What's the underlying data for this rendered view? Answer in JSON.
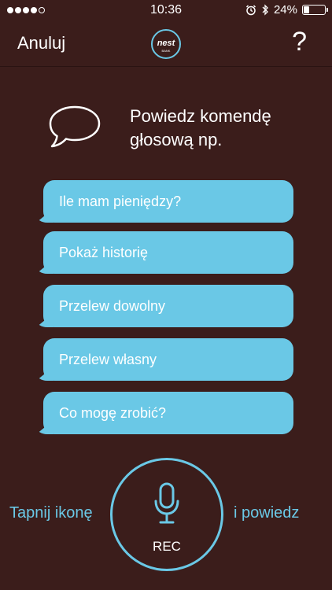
{
  "status_bar": {
    "time": "10:36",
    "battery_percent": "24%",
    "battery_level": 0.24,
    "signal_dots_filled": 4,
    "signal_dots_total": 5
  },
  "nav": {
    "cancel_label": "Anuluj",
    "logo_text": "nest",
    "logo_subtext": "BANK",
    "help_label": "?"
  },
  "prompt": {
    "line1": "Powiedz komendę",
    "line2": "głosową np."
  },
  "suggestions": [
    "Ile mam pieniędzy?",
    "Pokaż historię",
    "Przelew dowolny",
    "Przelew własny",
    "Co mogę zrobić?"
  ],
  "footer": {
    "left_hint": "Tapnij ikonę",
    "right_hint": "i powiedz",
    "rec_label": "REC"
  },
  "colors": {
    "background": "#3b1d1b",
    "accent": "#6ac8e6",
    "text": "#ffffff"
  }
}
